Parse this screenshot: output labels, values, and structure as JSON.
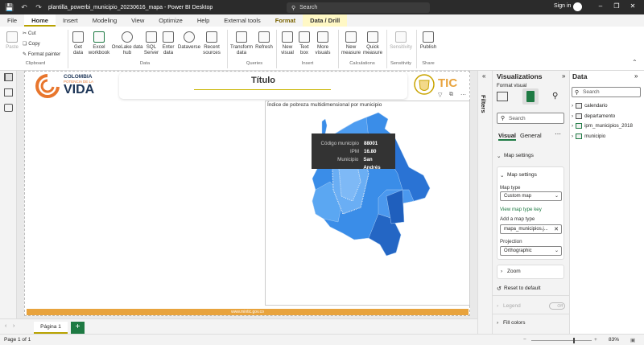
{
  "titlebar": {
    "file_title": "plantilla_powerbi_municipio_20230616_mapa - Power BI Desktop",
    "search_placeholder": "Search",
    "sign_in": "Sign in"
  },
  "menu": {
    "tabs": [
      "File",
      "Home",
      "Insert",
      "Modeling",
      "View",
      "Optimize",
      "Help",
      "External tools",
      "Format",
      "Data / Drill"
    ],
    "active_tab": "Home"
  },
  "ribbon": {
    "clipboard": {
      "paste": "Paste",
      "cut": "Cut",
      "copy": "Copy",
      "format_painter": "Format painter",
      "group": "Clipboard"
    },
    "data": {
      "get_data": "Get data",
      "excel": "Excel workbook",
      "onelake": "OneLake data hub",
      "sql": "SQL Server",
      "enter": "Enter data",
      "dataverse": "Dataverse",
      "recent": "Recent sources",
      "group": "Data"
    },
    "queries": {
      "transform": "Transform data",
      "refresh": "Refresh",
      "group": "Queries"
    },
    "insert": {
      "new_visual": "New visual",
      "text_box": "Text box",
      "more_visuals": "More visuals",
      "group": "Insert"
    },
    "calculations": {
      "new_measure": "New measure",
      "quick_measure": "Quick measure",
      "group": "Calculations"
    },
    "sensitivity": {
      "label": "Sensitivity",
      "group": "Sensitivity"
    },
    "share": {
      "publish": "Publish",
      "group": "Share"
    }
  },
  "report": {
    "logo_line1": "COLOMBIA",
    "logo_line2": "POTENCIA DE LA",
    "logo_line3": "VIDA",
    "title": "Título",
    "tic_logo": "TIC",
    "map_title": "Índice de pobreza multidimensional por municipio",
    "footer_url": "www.mintic.gov.co",
    "tooltip": [
      {
        "key": "Código municipio",
        "value": "88001"
      },
      {
        "key": "IPM",
        "value": "16.80"
      },
      {
        "key": "Municipio",
        "value": "San Andrés"
      }
    ]
  },
  "pages": {
    "tab": "Página 1",
    "add": "+"
  },
  "status": {
    "page_of": "Page 1 of 1",
    "zoom": "83%"
  },
  "filters": {
    "label": "Filters"
  },
  "visualizations": {
    "title": "Visualizations",
    "subtitle": "Format visual",
    "search_placeholder": "Search",
    "tab_visual": "Visual",
    "tab_general": "General",
    "section_map_settings": "Map settings",
    "card_map_settings": "Map settings",
    "map_type_label": "Map type",
    "map_type_value": "Custom map",
    "view_key_link": "View map type key",
    "add_map_type_label": "Add a map type",
    "add_map_type_value": "mapa_municipios.j...",
    "projection_label": "Projection",
    "projection_value": "Orthographic",
    "zoom": "Zoom",
    "reset": "Reset to default",
    "legend": "Legend",
    "legend_toggle": "Off",
    "fill_colors": "Fill colors"
  },
  "data_pane": {
    "title": "Data",
    "search_placeholder": "Search",
    "tables": [
      "calendario",
      "departamento",
      "ipm_municipios_2018",
      "municipio"
    ]
  },
  "colors": {
    "accent": "#b8a200",
    "map_blue": "#2b7fe0",
    "footer": "#e8a33d",
    "add_page": "#1e7a43"
  }
}
